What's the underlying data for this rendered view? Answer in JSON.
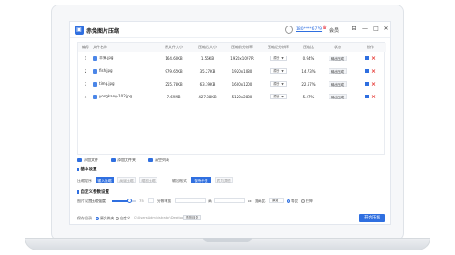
{
  "app": {
    "title": "赤兔图片压缩",
    "user_phone": "180****6779",
    "vip_label": "会员",
    "window_controls": [
      "⊟",
      "—",
      "□",
      "✕"
    ]
  },
  "table": {
    "columns": [
      "编号",
      "文件名称",
      "原文件大小",
      "压缩后大小",
      "压缩前分辨率",
      "压缩后分辨率",
      "压缩比",
      "状态",
      "操作"
    ],
    "rows": [
      {
        "index": "1",
        "name": "苹果.jpg",
        "orig_size": "164.60KB",
        "new_size": "1.56KB",
        "orig_res": "1920x1097R",
        "target_res": "原分",
        "ratio": "0.94%",
        "status": "输出完成"
      },
      {
        "index": "2",
        "name": "fish.jpg",
        "orig_size": "979.65KB",
        "new_size": "35.27KB",
        "orig_res": "1920x1080",
        "target_res": "原分",
        "ratio": "14.73%",
        "status": "输出完成"
      },
      {
        "index": "3",
        "name": "timg.jpg",
        "orig_size": "255.78KB",
        "new_size": "63.39KB",
        "orig_res": "1600x1200",
        "target_res": "原分",
        "ratio": "22.67%",
        "status": "输出完成"
      },
      {
        "index": "4",
        "name": "yongkang-102.jpg",
        "orig_size": "7.69MB",
        "new_size": "427.38KB",
        "orig_res": "5120x2880",
        "target_res": "原分",
        "ratio": "5.47%",
        "status": "输出完成"
      }
    ]
  },
  "toolbar": {
    "add_files": "添加文件",
    "add_folder": "添加文件夹",
    "clear_list": "清空列表"
  },
  "basic_settings": {
    "title": "基本设置",
    "mode_label": "压缩程序",
    "modes": [
      "输入压缩",
      "高级压缩",
      "缩放压缩"
    ],
    "output_format_label": "输出格式",
    "formats": [
      "保持不变",
      "转为其他"
    ]
  },
  "advanced_settings": {
    "title": "自定义参数设置",
    "quality_label": "图片设置",
    "quality_sublabel": "压缩强度",
    "quality_value": "75",
    "width_label": "分辨率宽",
    "height_label": "高",
    "unit": "px",
    "aspect_label": "宽高比",
    "aspect_value": "原始",
    "keep_ratio_label": "等比",
    "stretch_label": "拉伸"
  },
  "output": {
    "label": "保存目录",
    "option_original": "原文件夹",
    "option_custom": "自定义",
    "path": "C:\\Users\\Administrator\\Desktop\\图片压缩",
    "change_button": "更改目录"
  },
  "start_button": "开始压缩",
  "colors": {
    "accent": "#2f6fe0",
    "delete": "#e5322d",
    "vip": "#e8404b"
  }
}
